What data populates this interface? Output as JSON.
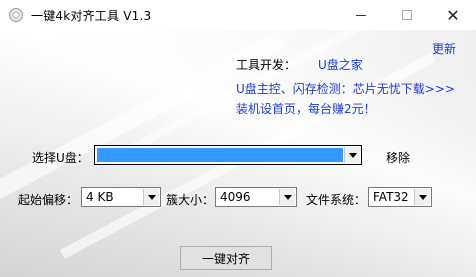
{
  "window": {
    "title": "一键4k对齐工具 V1.3"
  },
  "info": {
    "update_link": "更新",
    "dev_label": "工具开发：",
    "dev_name": "U盘之家",
    "promo_line": "U盘主控、闪存检测：芯片无忧下载>>>",
    "promo_line2": "装机设首页，每台赚2元！"
  },
  "form": {
    "select_disk_label": "选择U盘：",
    "select_disk_value": "",
    "remove_label": "移除",
    "offset_label": "起始偏移：",
    "offset_value": "4 KB",
    "cluster_label": "簇大小：",
    "cluster_value": "4096",
    "fs_label": "文件系统：",
    "fs_value": "FAT32"
  },
  "actions": {
    "align_button": "一键对齐"
  },
  "icons": {
    "app": "disc-icon",
    "minimize": "minimize-icon",
    "maximize": "maximize-icon",
    "close": "close-icon"
  }
}
